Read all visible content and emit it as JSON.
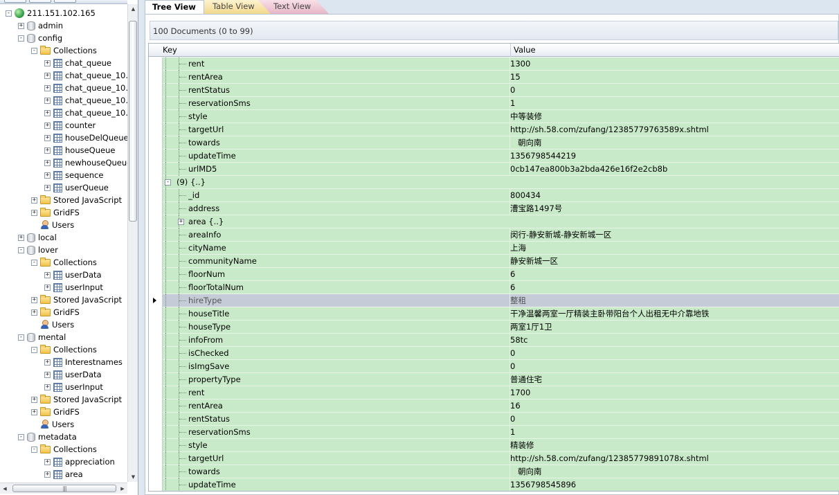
{
  "tree": {
    "server": "211.151.102.165",
    "nodes": [
      {
        "label": "admin",
        "type": "db",
        "depth": 1,
        "expand": "+"
      },
      {
        "label": "config",
        "type": "db",
        "depth": 1,
        "expand": "-"
      },
      {
        "label": "Collections",
        "type": "folder",
        "depth": 2,
        "expand": "-"
      },
      {
        "label": "chat_queue",
        "type": "coll",
        "depth": 3,
        "expand": "+"
      },
      {
        "label": "chat_queue_10.",
        "type": "coll",
        "depth": 3,
        "expand": "+"
      },
      {
        "label": "chat_queue_10.",
        "type": "coll",
        "depth": 3,
        "expand": "+"
      },
      {
        "label": "chat_queue_10.",
        "type": "coll",
        "depth": 3,
        "expand": "+"
      },
      {
        "label": "chat_queue_10.",
        "type": "coll",
        "depth": 3,
        "expand": "+"
      },
      {
        "label": "counter",
        "type": "coll",
        "depth": 3,
        "expand": "+"
      },
      {
        "label": "houseDelQueue",
        "type": "coll",
        "depth": 3,
        "expand": "+"
      },
      {
        "label": "houseQueue",
        "type": "coll",
        "depth": 3,
        "expand": "+"
      },
      {
        "label": "newhouseQueue",
        "type": "coll",
        "depth": 3,
        "expand": "+"
      },
      {
        "label": "sequence",
        "type": "coll",
        "depth": 3,
        "expand": "+"
      },
      {
        "label": "userQueue",
        "type": "coll",
        "depth": 3,
        "expand": "+"
      },
      {
        "label": "Stored JavaScript",
        "type": "folder",
        "depth": 2,
        "expand": "+"
      },
      {
        "label": "GridFS",
        "type": "folder",
        "depth": 2,
        "expand": "+"
      },
      {
        "label": "Users",
        "type": "user",
        "depth": 2,
        "expand": ""
      },
      {
        "label": "local",
        "type": "db",
        "depth": 1,
        "expand": "+"
      },
      {
        "label": "lover",
        "type": "db",
        "depth": 1,
        "expand": "-"
      },
      {
        "label": "Collections",
        "type": "folder",
        "depth": 2,
        "expand": "-"
      },
      {
        "label": "userData",
        "type": "coll",
        "depth": 3,
        "expand": "+"
      },
      {
        "label": "userInput",
        "type": "coll",
        "depth": 3,
        "expand": "+"
      },
      {
        "label": "Stored JavaScript",
        "type": "folder",
        "depth": 2,
        "expand": "+"
      },
      {
        "label": "GridFS",
        "type": "folder",
        "depth": 2,
        "expand": "+"
      },
      {
        "label": "Users",
        "type": "user",
        "depth": 2,
        "expand": ""
      },
      {
        "label": "mental",
        "type": "db",
        "depth": 1,
        "expand": "-"
      },
      {
        "label": "Collections",
        "type": "folder",
        "depth": 2,
        "expand": "-"
      },
      {
        "label": "Interestnames",
        "type": "coll",
        "depth": 3,
        "expand": "+"
      },
      {
        "label": "userData",
        "type": "coll",
        "depth": 3,
        "expand": "+"
      },
      {
        "label": "userInput",
        "type": "coll",
        "depth": 3,
        "expand": "+"
      },
      {
        "label": "Stored JavaScript",
        "type": "folder",
        "depth": 2,
        "expand": "+"
      },
      {
        "label": "GridFS",
        "type": "folder",
        "depth": 2,
        "expand": "+"
      },
      {
        "label": "Users",
        "type": "user",
        "depth": 2,
        "expand": ""
      },
      {
        "label": "metadata",
        "type": "db",
        "depth": 1,
        "expand": "-"
      },
      {
        "label": "Collections",
        "type": "folder",
        "depth": 2,
        "expand": "-"
      },
      {
        "label": "appreciation",
        "type": "coll",
        "depth": 3,
        "expand": "+"
      },
      {
        "label": "area",
        "type": "coll",
        "depth": 3,
        "expand": "+"
      }
    ]
  },
  "tabs": [
    {
      "label": "Tree View",
      "active": true
    },
    {
      "label": "Table View",
      "active": false
    },
    {
      "label": "Text View",
      "active": false
    }
  ],
  "doc_count_label": "100 Documents (0 to 99)",
  "grid": {
    "key_header": "Key",
    "value_header": "Value",
    "rows": [
      {
        "key": "rent",
        "value": "1300",
        "kind": "field"
      },
      {
        "key": "rentArea",
        "value": "15",
        "kind": "field"
      },
      {
        "key": "rentStatus",
        "value": "0",
        "kind": "field"
      },
      {
        "key": "reservationSms",
        "value": "1",
        "kind": "field"
      },
      {
        "key": "style",
        "value": "中等装修",
        "kind": "field"
      },
      {
        "key": "targetUrl",
        "value": "http://sh.58.com/zufang/12385779763589x.shtml",
        "kind": "field"
      },
      {
        "key": "towards",
        "value": "   朝向南",
        "kind": "field"
      },
      {
        "key": "updateTime",
        "value": "1356798544219",
        "kind": "field"
      },
      {
        "key": "urlMD5",
        "value": "0cb147ea800b3a2bda426e16f2e2cb8b",
        "kind": "field"
      },
      {
        "key": "(9) {..}",
        "value": "",
        "kind": "doc"
      },
      {
        "key": "_id",
        "value": "800434",
        "kind": "field"
      },
      {
        "key": "address",
        "value": "漕宝路1497号",
        "kind": "field"
      },
      {
        "key": "area {..}",
        "value": "",
        "kind": "sub"
      },
      {
        "key": "areaInfo",
        "value": "闵行-静安新城-静安新城一区",
        "kind": "field"
      },
      {
        "key": "cityName",
        "value": "上海",
        "kind": "field"
      },
      {
        "key": "communityName",
        "value": "静安新城一区",
        "kind": "field"
      },
      {
        "key": "floorNum",
        "value": "6",
        "kind": "field"
      },
      {
        "key": "floorTotalNum",
        "value": "6",
        "kind": "field"
      },
      {
        "key": "hireType",
        "value": "整租",
        "kind": "field",
        "current": true
      },
      {
        "key": "houseTitle",
        "value": "干净温馨两室一厅精装主卧带阳台个人出租无中介靠地铁",
        "kind": "field"
      },
      {
        "key": "houseType",
        "value": "两室1厅1卫",
        "kind": "field"
      },
      {
        "key": "infoFrom",
        "value": "58tc",
        "kind": "field"
      },
      {
        "key": "isChecked",
        "value": "0",
        "kind": "field"
      },
      {
        "key": "isImgSave",
        "value": "0",
        "kind": "field"
      },
      {
        "key": "propertyType",
        "value": "普通住宅",
        "kind": "field"
      },
      {
        "key": "rent",
        "value": "1700",
        "kind": "field"
      },
      {
        "key": "rentArea",
        "value": "16",
        "kind": "field"
      },
      {
        "key": "rentStatus",
        "value": "0",
        "kind": "field"
      },
      {
        "key": "reservationSms",
        "value": "1",
        "kind": "field"
      },
      {
        "key": "style",
        "value": "精装修",
        "kind": "field"
      },
      {
        "key": "targetUrl",
        "value": "http://sh.58.com/zufang/12385779891078x.shtml",
        "kind": "field"
      },
      {
        "key": "towards",
        "value": "   朝向南",
        "kind": "field"
      },
      {
        "key": "updateTime",
        "value": "1356798545896",
        "kind": "field"
      }
    ]
  }
}
